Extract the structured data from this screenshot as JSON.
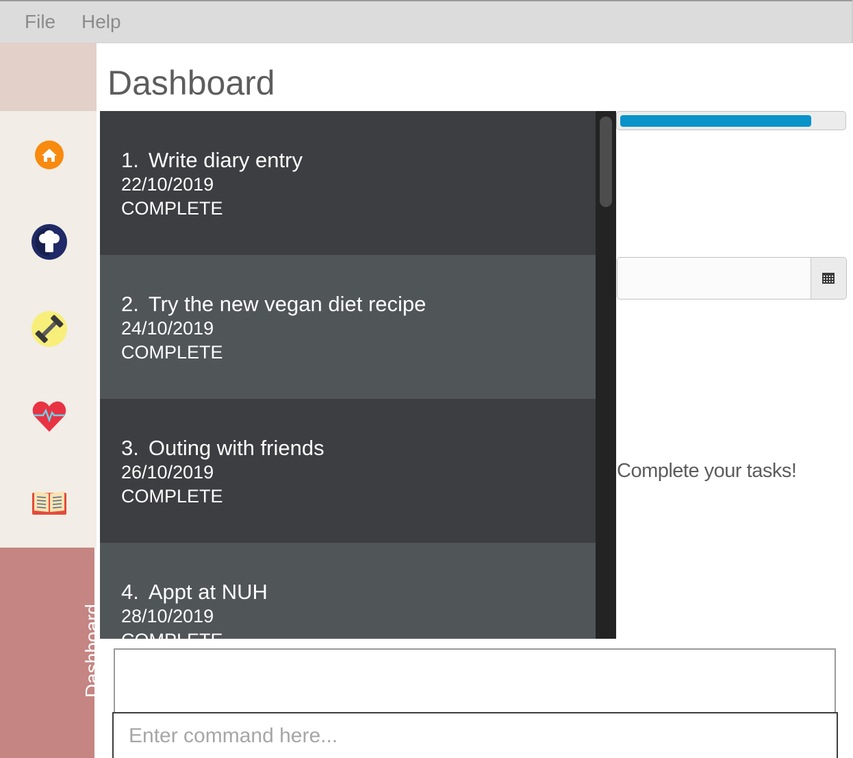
{
  "menu": {
    "items": [
      "File",
      "Help"
    ]
  },
  "page": {
    "title": "Dashboard"
  },
  "sidebar": {
    "icons": [
      "home-icon",
      "chef-hat-icon",
      "dumbbell-icon",
      "heart-rate-icon",
      "recipe-book-icon"
    ],
    "active_tab": "Dashboard"
  },
  "tasks": [
    {
      "number": "1.",
      "title": "Write diary entry",
      "date": "22/10/2019",
      "status": "COMPLETE"
    },
    {
      "number": "2.",
      "title": "Try the new vegan diet recipe",
      "date": "24/10/2019",
      "status": "COMPLETE"
    },
    {
      "number": "3.",
      "title": "Outing with friends",
      "date": "26/10/2019",
      "status": "COMPLETE"
    },
    {
      "number": "4.",
      "title": "Appt at NUH",
      "date": "28/10/2019",
      "status": "COMPLETE"
    }
  ],
  "progress": {
    "fraction": 0.86
  },
  "date_picker": {
    "value": ""
  },
  "motivation_text": "Complete your tasks!",
  "result_display": {
    "text": ""
  },
  "command": {
    "placeholder": "Enter command here..."
  },
  "colors": {
    "progress_fill": "#0993c9",
    "sidebar_active": "#c58582",
    "card_dark": "#3d3e41",
    "card_light": "#505558"
  }
}
